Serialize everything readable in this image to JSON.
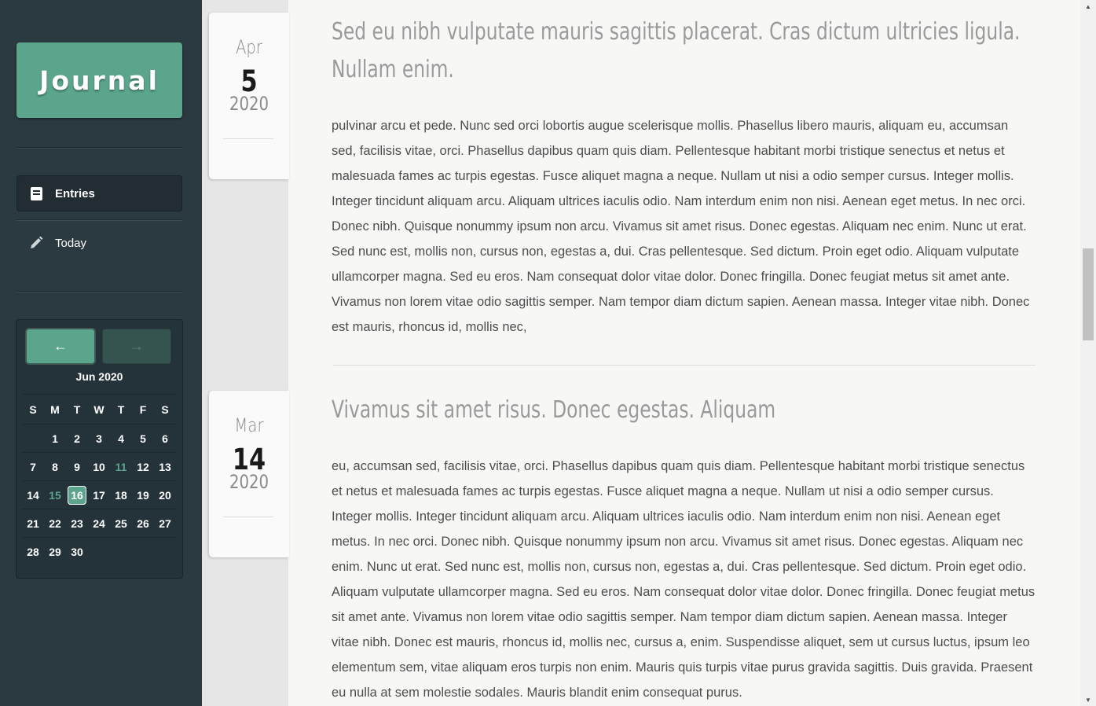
{
  "app": {
    "logo": "Journal"
  },
  "nav": {
    "entries": {
      "label": "Entries",
      "icon": "book-icon"
    },
    "today": {
      "label": "Today",
      "icon": "pencil-icon"
    }
  },
  "calendar": {
    "prev_label": "←",
    "next_label": "→",
    "month": "Jun 2020",
    "weekdays": [
      "S",
      "M",
      "T",
      "W",
      "T",
      "F",
      "S"
    ],
    "weeks": [
      [
        "",
        "1",
        "2",
        "3",
        "4",
        "5",
        "6"
      ],
      [
        "7",
        "8",
        "9",
        "10",
        "11",
        "12",
        "13"
      ],
      [
        "14",
        "15",
        "16",
        "17",
        "18",
        "19",
        "20"
      ],
      [
        "21",
        "22",
        "23",
        "24",
        "25",
        "26",
        "27"
      ],
      [
        "28",
        "29",
        "30",
        "",
        "",
        "",
        ""
      ]
    ],
    "highlighted_days": [
      "11",
      "15"
    ],
    "selected_day": "16",
    "accent": "#5aa58b"
  },
  "entries": [
    {
      "month": "Apr",
      "day": "5",
      "year": "2020",
      "title": "Sed eu nibh vulputate mauris sagittis placerat. Cras dictum ultricies ligula. Nullam enim.",
      "body": "pulvinar arcu et pede. Nunc sed orci lobortis augue scelerisque mollis. Phasellus libero mauris, aliquam eu, accumsan sed, facilisis vitae, orci. Phasellus dapibus quam quis diam. Pellentesque habitant morbi tristique senectus et netus et malesuada fames ac turpis egestas. Fusce aliquet magna a neque. Nullam ut nisi a odio semper cursus. Integer mollis. Integer tincidunt aliquam arcu. Aliquam ultrices iaculis odio. Nam interdum enim non nisi. Aenean eget metus. In nec orci. Donec nibh. Quisque nonummy ipsum non arcu. Vivamus sit amet risus. Donec egestas. Aliquam nec enim. Nunc ut erat. Sed nunc est, mollis non, cursus non, egestas a, dui. Cras pellentesque. Sed dictum. Proin eget odio. Aliquam vulputate ullamcorper magna. Sed eu eros. Nam consequat dolor vitae dolor. Donec fringilla. Donec feugiat metus sit amet ante. Vivamus non lorem vitae odio sagittis semper. Nam tempor diam dictum sapien. Aenean massa. Integer vitae nibh. Donec est mauris, rhoncus id, mollis nec,"
    },
    {
      "month": "Mar",
      "day": "14",
      "year": "2020",
      "title": "Vivamus sit amet risus. Donec egestas. Aliquam",
      "body": "eu, accumsan sed, facilisis vitae, orci. Phasellus dapibus quam quis diam. Pellentesque habitant morbi tristique senectus et netus et malesuada fames ac turpis egestas. Fusce aliquet magna a neque. Nullam ut nisi a odio semper cursus. Integer mollis. Integer tincidunt aliquam arcu. Aliquam ultrices iaculis odio. Nam interdum enim non nisi. Aenean eget metus. In nec orci. Donec nibh. Quisque nonummy ipsum non arcu. Vivamus sit amet risus. Donec egestas. Aliquam nec enim. Nunc ut erat. Sed nunc est, mollis non, cursus non, egestas a, dui. Cras pellentesque. Sed dictum. Proin eget odio. Aliquam vulputate ullamcorper magna. Sed eu eros. Nam consequat dolor vitae dolor. Donec fringilla. Donec feugiat metus sit amet ante. Vivamus non lorem vitae odio sagittis semper. Nam tempor diam dictum sapien. Aenean massa. Integer vitae nibh. Donec est mauris, rhoncus id, mollis nec, cursus a, enim. Suspendisse aliquet, sem ut cursus luctus, ipsum leo elementum sem, vitae aliquam eros turpis non enim. Mauris quis turpis vitae purus gravida sagittis. Duis gravida. Praesent eu nulla at sem molestie sodales. Mauris blandit enim consequat purus."
    }
  ]
}
